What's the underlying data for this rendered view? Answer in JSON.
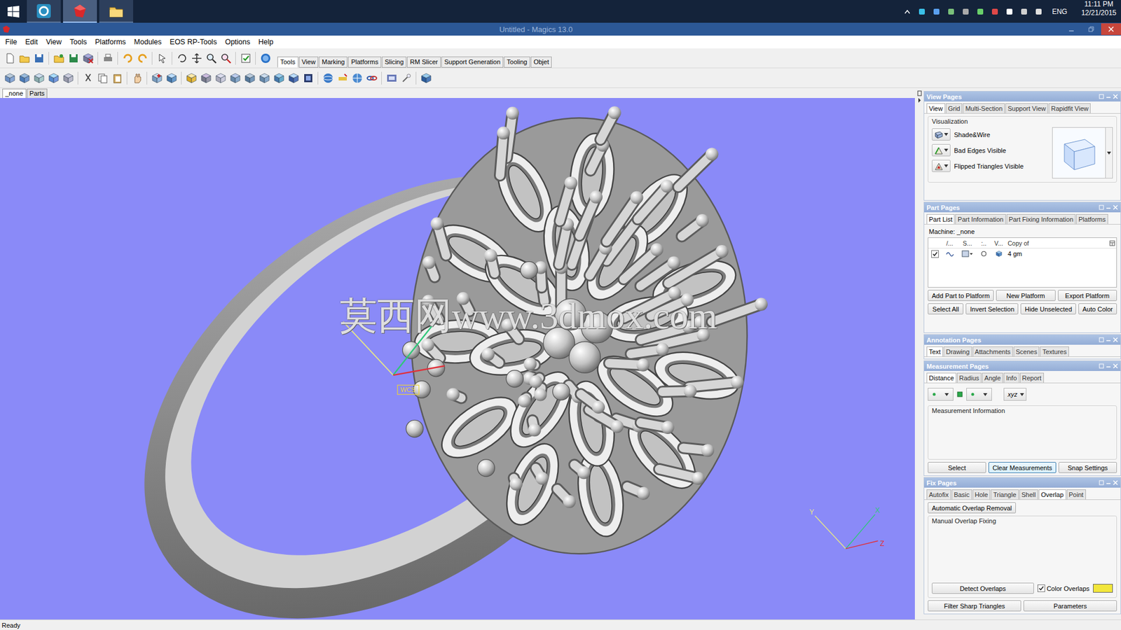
{
  "taskbar": {
    "apps": [
      {
        "kind": "vcs",
        "active": false
      },
      {
        "kind": "magics",
        "active": true
      },
      {
        "kind": "explorer",
        "active": false
      }
    ],
    "language": "ENG",
    "time": "11:11 PM",
    "date": "12/21/2015"
  },
  "window": {
    "title": "Untitled - Magics 13.0"
  },
  "menu": [
    "File",
    "Edit",
    "View",
    "Tools",
    "Platforms",
    "Modules",
    "EOS RP-Tools",
    "Options",
    "Help"
  ],
  "toolbar_tabs": [
    {
      "label": "Tools",
      "selected": true
    },
    {
      "label": "View",
      "selected": false
    },
    {
      "label": "Marking",
      "selected": false
    },
    {
      "label": "Platforms",
      "selected": false
    },
    {
      "label": "Slicing",
      "selected": false
    },
    {
      "label": "RM Slicer",
      "selected": false
    },
    {
      "label": "Support Generation",
      "selected": false
    },
    {
      "label": "Tooling",
      "selected": false
    },
    {
      "label": "Objet",
      "selected": false
    }
  ],
  "document_tabs": [
    {
      "label": "_none",
      "selected": true
    },
    {
      "label": "Parts",
      "selected": false
    }
  ],
  "viewport": {
    "watermark": "莫西网www.3dmox.com",
    "gizmo_label": "WCS",
    "axes": [
      {
        "label": "Y",
        "color": "#e6e68a"
      },
      {
        "label": "X",
        "color": "#2fc77a"
      },
      {
        "label": "Z",
        "color": "#e0303a"
      }
    ]
  },
  "panels": {
    "view": {
      "title": "View Pages",
      "tabs": [
        {
          "label": "View",
          "selected": true
        },
        {
          "label": "Grid",
          "selected": false
        },
        {
          "label": "Multi-Section",
          "selected": false
        },
        {
          "label": "Support View",
          "selected": false
        },
        {
          "label": "Rapidfit View",
          "selected": false
        }
      ],
      "group": "Visualization",
      "options": [
        {
          "label": "Shade&Wire",
          "kind": "shade"
        },
        {
          "label": "Bad Edges Visible",
          "kind": "edges"
        },
        {
          "label": "Flipped Triangles Visible",
          "kind": "flipped"
        }
      ]
    },
    "part": {
      "title": "Part Pages",
      "tabs": [
        {
          "label": "Part List",
          "selected": true
        },
        {
          "label": "Part Information",
          "selected": false
        },
        {
          "label": "Part Fixing Information",
          "selected": false
        },
        {
          "label": "Platforms",
          "selected": false
        }
      ],
      "machine": "Machine: _none",
      "columns": [
        "/...",
        "S...",
        ":..",
        "V...",
        "Copy of"
      ],
      "rows": [
        {
          "checked": true,
          "name": "4 gm"
        }
      ],
      "buttons": [
        [
          "Add Part to Platform",
          "New Platform",
          "Export Platform"
        ],
        [
          "Select All",
          "Invert Selection",
          "Hide Unselected",
          "Auto Color"
        ]
      ]
    },
    "annotation": {
      "title": "Annotation Pages",
      "tabs": [
        {
          "label": "Text",
          "selected": true
        },
        {
          "label": "Drawing",
          "selected": false
        },
        {
          "label": "Attachments",
          "selected": false
        },
        {
          "label": "Scenes",
          "selected": false
        },
        {
          "label": "Textures",
          "selected": false
        }
      ]
    },
    "measurement": {
      "title": "Measurement Pages",
      "tabs": [
        {
          "label": "Distance",
          "selected": true
        },
        {
          "label": "Radius",
          "selected": false
        },
        {
          "label": "Angle",
          "selected": false
        },
        {
          "label": "Info",
          "selected": false
        },
        {
          "label": "Report",
          "selected": false
        }
      ],
      "coordinates": "xyz",
      "group": "Measurement Information",
      "buttons": [
        {
          "label": "Select",
          "focused": false
        },
        {
          "label": "Clear Measurements",
          "focused": true
        },
        {
          "label": "Snap Settings",
          "focused": false
        }
      ]
    },
    "fix": {
      "title": "Fix Pages",
      "tabs": [
        {
          "label": "Autofix",
          "selected": false
        },
        {
          "label": "Basic",
          "selected": false
        },
        {
          "label": "Hole",
          "selected": false
        },
        {
          "label": "Triangle",
          "selected": false
        },
        {
          "label": "Shell",
          "selected": false
        },
        {
          "label": "Overlap",
          "selected": true
        },
        {
          "label": "Point",
          "selected": false
        }
      ],
      "auto_button": "Automatic Overlap Removal",
      "group": "Manual Overlap Fixing",
      "detect_button": "Detect Overlaps",
      "color_overlaps": {
        "label": "Color Overlaps",
        "checked": true,
        "color": "#f2e63c"
      },
      "buttons": [
        "Filter Sharp Triangles",
        "Parameters"
      ]
    }
  },
  "status_bar": "Ready"
}
